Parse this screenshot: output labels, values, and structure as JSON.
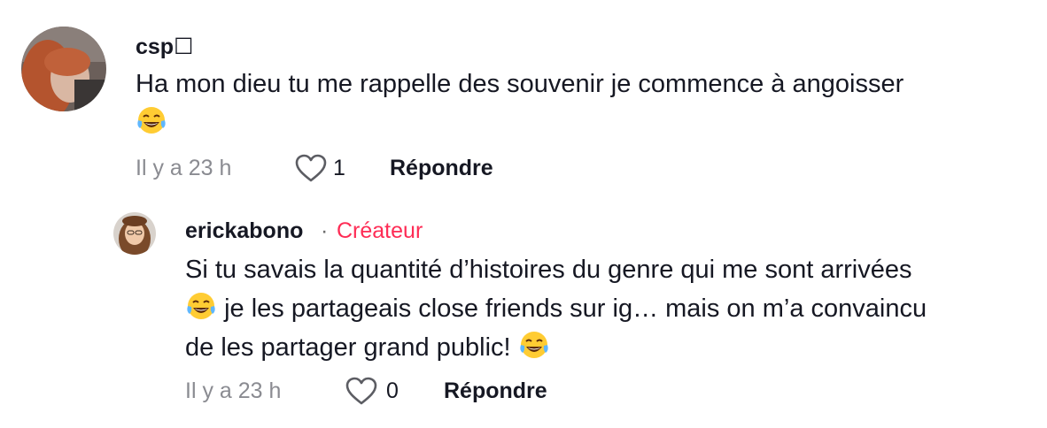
{
  "comment": {
    "username": "csp☐",
    "text_line1": "Ha mon dieu tu me rappelle des souvenir je commence à angoisser",
    "emoji_name": "face-with-tears-of-joy-emoji",
    "time": "Il y a 23 h",
    "like_count": "1",
    "reply_label": "Répondre"
  },
  "reply": {
    "username": "erickabono",
    "separator": "·",
    "badge": "Créateur",
    "text_line1": "Si tu savais la quantité d’histoires du genre qui me sont arrivées",
    "text_line2": "je les partageais close friends sur ig… mais on m’a convaincu",
    "text_line3": "de les partager grand public!",
    "time": "Il y a 23 h",
    "like_count": "0",
    "reply_label": "Répondre"
  },
  "colors": {
    "creator_badge": "#fe2c55",
    "meta_text": "#8a8b91",
    "primary_text": "#161823"
  }
}
